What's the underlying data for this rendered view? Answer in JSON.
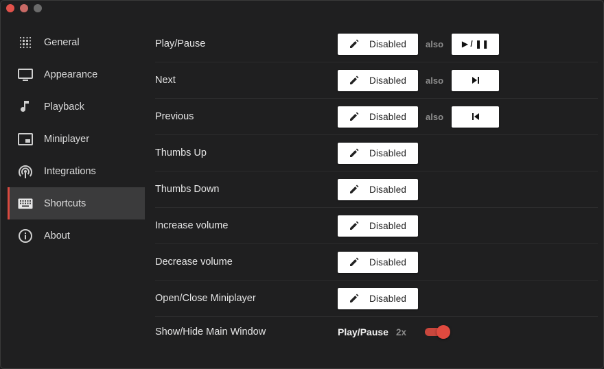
{
  "sidebar": {
    "items": [
      {
        "label": "General",
        "icon": "dots-grid-icon"
      },
      {
        "label": "Appearance",
        "icon": "monitor-icon"
      },
      {
        "label": "Playback",
        "icon": "music-note-icon"
      },
      {
        "label": "Miniplayer",
        "icon": "miniplayer-icon"
      },
      {
        "label": "Integrations",
        "icon": "broadcast-icon"
      },
      {
        "label": "Shortcuts",
        "icon": "keyboard-icon",
        "active": true
      },
      {
        "label": "About",
        "icon": "info-icon"
      }
    ]
  },
  "shortcuts": {
    "also_label": "also",
    "rows": [
      {
        "label": "Play/Pause",
        "button": "Disabled",
        "media_key": "▶ / ❚❚"
      },
      {
        "label": "Next",
        "button": "Disabled",
        "media_key": "next-track"
      },
      {
        "label": "Previous",
        "button": "Disabled",
        "media_key": "previous-track"
      },
      {
        "label": "Thumbs Up",
        "button": "Disabled"
      },
      {
        "label": "Thumbs Down",
        "button": "Disabled"
      },
      {
        "label": "Increase volume",
        "button": "Disabled"
      },
      {
        "label": "Decrease volume",
        "button": "Disabled"
      },
      {
        "label": "Open/Close Miniplayer",
        "button": "Disabled"
      }
    ],
    "show_hide": {
      "label": "Show/Hide Main Window",
      "key": "Play/Pause",
      "multiplier": "2x",
      "toggle_on": true
    }
  },
  "colors": {
    "accent": "#d9493f",
    "background": "#1f1f20",
    "sidebar_active": "#3b3b3c"
  }
}
